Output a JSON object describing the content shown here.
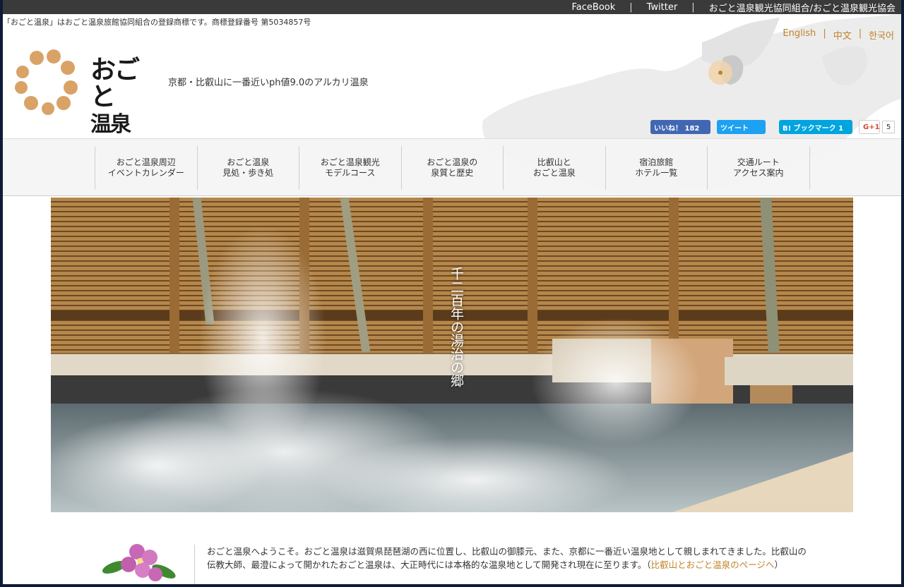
{
  "topbar": {
    "links": [
      "FaceBook",
      "Twitter",
      "おごと温泉観光協同組合/おごと温泉観光協会"
    ],
    "separator": "|"
  },
  "trademark": "「おごと温泉」はおごと温泉旅館協同組合の登録商標です。商標登録番号 第5034857号",
  "languages": [
    "English",
    "中文",
    "한국어"
  ],
  "lang_separator": "|",
  "logo": {
    "line1": "おごと",
    "line2": "温泉"
  },
  "tagline": "京都・比叡山に一番近いph値9.0のアルカリ温泉",
  "social": {
    "facebook": "いいね！ 182",
    "twitter": "ツイート",
    "hatena": "B! ブックマーク  1",
    "gplus": "G+1",
    "gplus_count": "5"
  },
  "nav": [
    {
      "line1": "おごと温泉周辺",
      "line2": "イベントカレンダー"
    },
    {
      "line1": "おごと温泉",
      "line2": "見処・歩き処"
    },
    {
      "line1": "おごと温泉観光",
      "line2": "モデルコース"
    },
    {
      "line1": "おごと温泉の",
      "line2": "泉質と歴史"
    },
    {
      "line1": "比叡山と",
      "line2": "おごと温泉"
    },
    {
      "line1": "宿泊旅館",
      "line2": "ホテル一覧"
    },
    {
      "line1": "交通ルート",
      "line2": "アクセス案内"
    }
  ],
  "hero_caption": "千二百年の湯治の郷",
  "intro": {
    "text": "おごと温泉へようこそ。おごと温泉は滋賀県琵琶湖の西に位置し、比叡山の御膝元、また、京都に一番近い温泉地として親しまれてきました。比叡山の伝教大師、最澄によって開かれたおごと温泉は、大正時代には本格的な温泉地として開発され現在に至ります。（",
    "link": "比叡山とおごと温泉のページへ",
    "tail": "）"
  },
  "colors": {
    "accent": "#c0832a",
    "topbar": "#3a3a3a",
    "logo_dot": "#d9a266"
  }
}
